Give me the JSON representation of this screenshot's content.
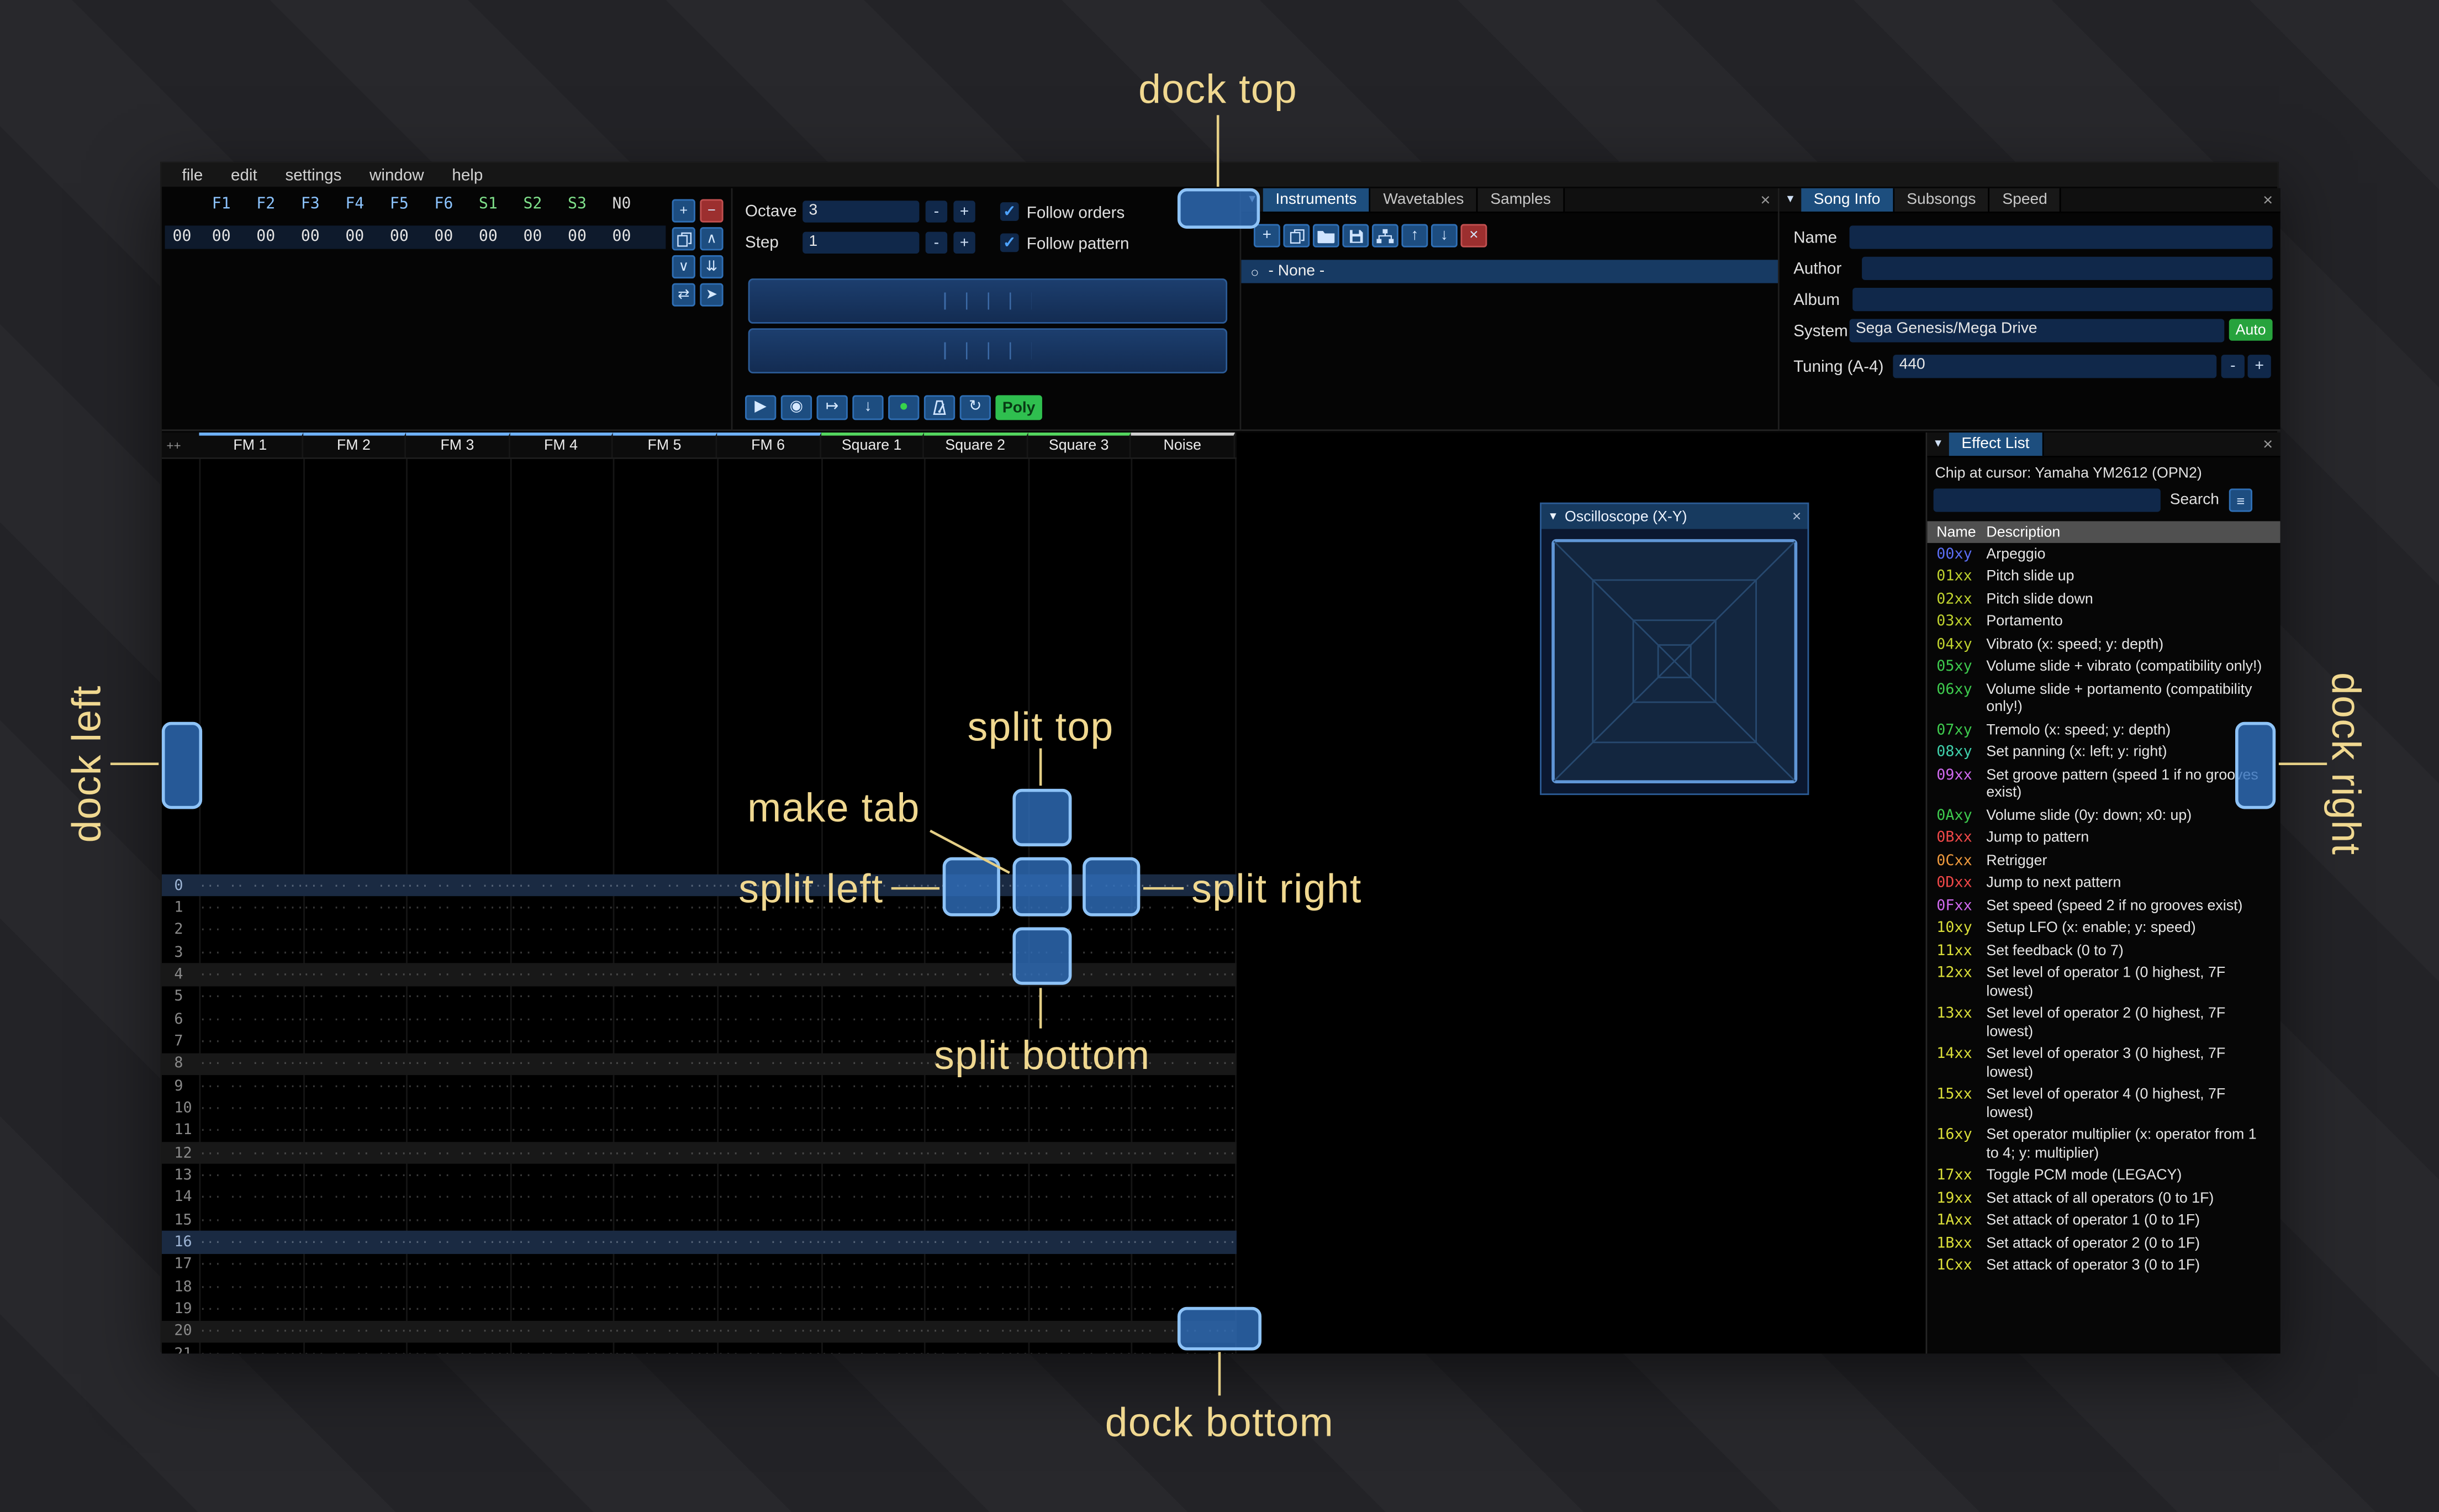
{
  "icons": {
    "caret": "▼",
    "close": "×",
    "hamburger": "≡",
    "radio": "○",
    "check": "✓"
  },
  "menu": {
    "items": [
      "file",
      "edit",
      "settings",
      "window",
      "help"
    ]
  },
  "orders": {
    "row_label": "00",
    "channels": [
      {
        "name": "F1",
        "color": "#8cc4ff"
      },
      {
        "name": "F2",
        "color": "#8cc4ff"
      },
      {
        "name": "F3",
        "color": "#8cc4ff"
      },
      {
        "name": "F4",
        "color": "#8cc4ff"
      },
      {
        "name": "F5",
        "color": "#8cc4ff"
      },
      {
        "name": "F6",
        "color": "#8cc4ff"
      },
      {
        "name": "S1",
        "color": "#7fe08a"
      },
      {
        "name": "S2",
        "color": "#7fe08a"
      },
      {
        "name": "S3",
        "color": "#7fe08a"
      },
      {
        "name": "N0",
        "color": "#d8d8d8"
      }
    ],
    "values": [
      "00",
      "00",
      "00",
      "00",
      "00",
      "00",
      "00",
      "00",
      "00",
      "00"
    ],
    "buttons": [
      {
        "name": "order-add-button",
        "icon": "add-icon",
        "glyph": "+",
        "variant": "blue"
      },
      {
        "name": "order-remove-button",
        "icon": "minus-icon",
        "glyph": "−",
        "variant": "red"
      },
      {
        "name": "order-duplicate-button",
        "icon": "duplicate-icon",
        "svg": "duplicate",
        "variant": "blue"
      },
      {
        "name": "order-move-up-button",
        "icon": "chevron-up-icon",
        "glyph": "∧",
        "variant": "blue"
      },
      {
        "name": "order-move-down-button",
        "icon": "chevron-down-icon",
        "glyph": "∨",
        "variant": "blue"
      },
      {
        "name": "order-deep-clone-button",
        "icon": "double-chevron-down-icon",
        "glyph": "⇊",
        "variant": "blue"
      },
      {
        "name": "order-change-mode-button",
        "icon": "swap-icon",
        "glyph": "⇄",
        "variant": "blue"
      },
      {
        "name": "order-edit-button",
        "icon": "pointer-icon",
        "glyph": "➤",
        "variant": "blue"
      }
    ]
  },
  "controls": {
    "octave_label": "Octave",
    "octave_value": "3",
    "step_label": "Step",
    "step_value": "1",
    "minus_label": "-",
    "plus_label": "+",
    "follow_orders_label": "Follow orders",
    "follow_pattern_label": "Follow pattern",
    "poly_label": "Poly",
    "playback": [
      {
        "name": "play-button",
        "icon": "play-icon",
        "glyph": "▶"
      },
      {
        "name": "play-pattern-button",
        "icon": "play-circle-icon",
        "glyph": "◉"
      },
      {
        "name": "play-from-cursor-button",
        "icon": "play-row-icon",
        "glyph": "↦"
      },
      {
        "name": "step-row-button",
        "icon": "arrow-down-icon",
        "glyph": "↓"
      },
      {
        "name": "record-button",
        "icon": "record-icon",
        "glyph": "●",
        "color": "#37d44b"
      },
      {
        "name": "metronome-button",
        "icon": "metronome-icon",
        "svg": "metronome"
      },
      {
        "name": "repeat-pattern-button",
        "icon": "repeat-icon",
        "glyph": "↻"
      }
    ]
  },
  "instruments": {
    "tabs": [
      "Instruments",
      "Wavetables",
      "Samples"
    ],
    "active_tab": "Instruments",
    "toolbar": [
      {
        "name": "instrument-add-button",
        "icon": "add-icon",
        "glyph": "+"
      },
      {
        "name": "instrument-duplicate-button",
        "icon": "duplicate-icon",
        "svg": "duplicate"
      },
      {
        "name": "instrument-open-button",
        "icon": "folder-open-icon",
        "svg": "folder"
      },
      {
        "name": "instrument-save-button",
        "icon": "save-icon",
        "svg": "floppy"
      },
      {
        "name": "instrument-organize-button",
        "icon": "sitemap-icon",
        "svg": "sitemap"
      },
      {
        "name": "instrument-move-up-button",
        "icon": "arrow-up-icon",
        "glyph": "↑"
      },
      {
        "name": "instrument-move-down-button",
        "icon": "arrow-down-icon",
        "glyph": "↓"
      },
      {
        "name": "instrument-delete-button",
        "icon": "delete-icon",
        "glyph": "×",
        "variant": "red"
      }
    ],
    "list": [
      {
        "label": "- None -",
        "selected": true
      }
    ]
  },
  "song_info": {
    "tabs": [
      "Song Info",
      "Subsongs",
      "Speed"
    ],
    "active_tab": "Song Info",
    "name_label": "Name",
    "name_value": "",
    "author_label": "Author",
    "author_value": "",
    "album_label": "Album",
    "album_value": "",
    "system_label": "System",
    "system_value": "Sega Genesis/Mega Drive",
    "auto_label": "Auto",
    "tuning_label": "Tuning (A-4)",
    "tuning_value": "440",
    "minus_label": "-",
    "plus_label": "+"
  },
  "pattern": {
    "corner_label": "++",
    "visible_rows": 22,
    "empty_cell": "··· ·· ·· ····",
    "channels": [
      {
        "name": "FM 1",
        "color": "#6fb2ff"
      },
      {
        "name": "FM 2",
        "color": "#6fb2ff"
      },
      {
        "name": "FM 3",
        "color": "#6fb2ff"
      },
      {
        "name": "FM 4",
        "color": "#6fb2ff"
      },
      {
        "name": "FM 5",
        "color": "#6fb2ff"
      },
      {
        "name": "FM 6",
        "color": "#6fb2ff"
      },
      {
        "name": "Square 1",
        "color": "#54d65f"
      },
      {
        "name": "Square 2",
        "color": "#54d65f"
      },
      {
        "name": "Square 3",
        "color": "#54d65f"
      },
      {
        "name": "Noise",
        "color": "#cfcfcf"
      }
    ]
  },
  "effect_list": {
    "tab_label": "Effect List",
    "chip_label": "Chip at cursor: Yamaha YM2612 (OPN2)",
    "search_label": "Search",
    "search_value": "",
    "name_header": "Name",
    "description_header": "Description",
    "effects": [
      {
        "code": "00xy",
        "color": "#5b6ef5",
        "desc": "Arpeggio"
      },
      {
        "code": "01xx",
        "color": "#bfd22e",
        "desc": "Pitch slide up"
      },
      {
        "code": "02xx",
        "color": "#bfd22e",
        "desc": "Pitch slide down"
      },
      {
        "code": "03xx",
        "color": "#bfd22e",
        "desc": "Portamento"
      },
      {
        "code": "04xy",
        "color": "#bfd22e",
        "desc": "Vibrato (x: speed; y: depth)"
      },
      {
        "code": "05xy",
        "color": "#3ecb4e",
        "desc": "Volume slide + vibrato (compatibility only!)"
      },
      {
        "code": "06xy",
        "color": "#3ecb4e",
        "desc": "Volume slide + portamento (compatibility only!)"
      },
      {
        "code": "07xy",
        "color": "#3ecb4e",
        "desc": "Tremolo (x: speed; y: depth)"
      },
      {
        "code": "08xy",
        "color": "#3fd0ab",
        "desc": "Set panning (x: left; y: right)"
      },
      {
        "code": "09xx",
        "color": "#d069ef",
        "desc": "Set groove pattern (speed 1 if no grooves exist)"
      },
      {
        "code": "0Axy",
        "color": "#3ecb4e",
        "desc": "Volume slide (0y: down; x0: up)"
      },
      {
        "code": "0Bxx",
        "color": "#ef4848",
        "desc": "Jump to pattern"
      },
      {
        "code": "0Cxx",
        "color": "#ef9a3d",
        "desc": "Retrigger"
      },
      {
        "code": "0Dxx",
        "color": "#ef4848",
        "desc": "Jump to next pattern"
      },
      {
        "code": "0Fxx",
        "color": "#d069ef",
        "desc": "Set speed (speed 2 if no grooves exist)"
      },
      {
        "code": "10xy",
        "color": "#dade39",
        "desc": "Setup LFO (x: enable; y: speed)"
      },
      {
        "code": "11xx",
        "color": "#dade39",
        "desc": "Set feedback (0 to 7)"
      },
      {
        "code": "12xx",
        "color": "#dade39",
        "desc": "Set level of operator 1 (0 highest, 7F lowest)"
      },
      {
        "code": "13xx",
        "color": "#dade39",
        "desc": "Set level of operator 2 (0 highest, 7F lowest)"
      },
      {
        "code": "14xx",
        "color": "#dade39",
        "desc": "Set level of operator 3 (0 highest, 7F lowest)"
      },
      {
        "code": "15xx",
        "color": "#dade39",
        "desc": "Set level of operator 4 (0 highest, 7F lowest)"
      },
      {
        "code": "16xy",
        "color": "#dade39",
        "desc": "Set operator multiplier (x: operator from 1 to 4; y: multiplier)"
      },
      {
        "code": "17xx",
        "color": "#dade39",
        "desc": "Toggle PCM mode (LEGACY)"
      },
      {
        "code": "19xx",
        "color": "#dade39",
        "desc": "Set attack of all operators (0 to 1F)"
      },
      {
        "code": "1Axx",
        "color": "#dade39",
        "desc": "Set attack of operator 1 (0 to 1F)"
      },
      {
        "code": "1Bxx",
        "color": "#dade39",
        "desc": "Set attack of operator 2 (0 to 1F)"
      },
      {
        "code": "1Cxx",
        "color": "#dade39",
        "desc": "Set attack of operator 3 (0 to 1F)"
      }
    ]
  },
  "oscilloscope": {
    "title": "Oscilloscope (X-Y)"
  },
  "dock_overlay": {
    "dock_top": "dock top",
    "dock_bottom": "dock bottom",
    "dock_left": "dock left",
    "dock_right": "dock right",
    "split_top": "split top",
    "split_bottom": "split bottom",
    "split_left": "split left",
    "split_right": "split right",
    "make_tab": "make tab"
  }
}
